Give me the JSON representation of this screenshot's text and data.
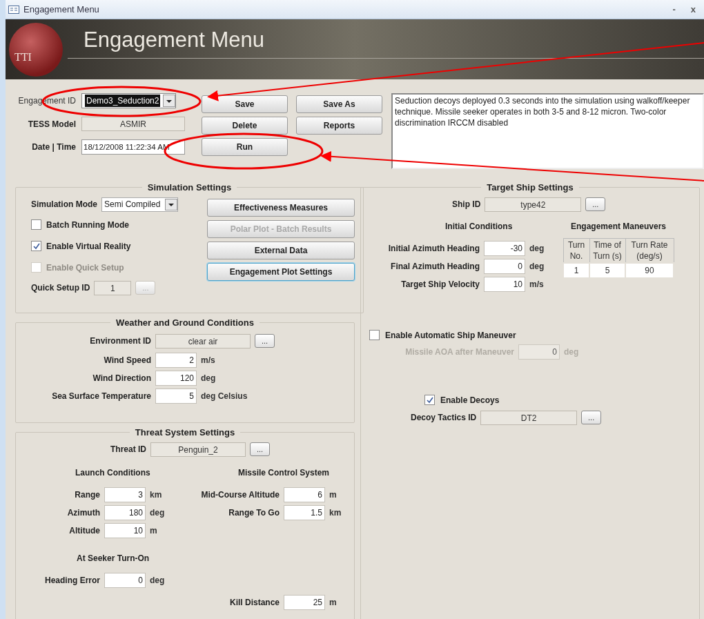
{
  "window": {
    "title": "Engagement Menu",
    "controls": [
      "-",
      "x"
    ]
  },
  "header": {
    "title": "Engagement Menu",
    "logo_text": "TTI"
  },
  "engagement": {
    "id_label": "Engagement ID",
    "id_value": "Demo3_Seduction2",
    "id_highlighted": true,
    "model_label": "TESS Model",
    "model_value": "ASMIR",
    "datetime_label": "Date | Time",
    "datetime_value": "18/12/2008 11:22:34 AM"
  },
  "buttons": [
    {
      "label": "Save"
    },
    {
      "label": "Save As"
    },
    {
      "label": "Delete"
    },
    {
      "label": "Reports"
    },
    {
      "label": "Run"
    }
  ],
  "description": "Seduction decoys deployed 0.3 seconds into the simulation using walkoff/keeper technique.  Missile seeker operates in both 3-5  and 8-12 micron.  Two-color discrimination IRCCM disabled",
  "simulation": {
    "title": "Simulation Settings",
    "mode_label": "Simulation Mode",
    "mode_value": "Semi Compiled",
    "checkboxes": [
      {
        "label": "Batch Running Mode",
        "checked": false,
        "disabled": false
      },
      {
        "label": "Enable Virtual Reality",
        "checked": true,
        "disabled": false
      },
      {
        "label": "Enable Quick Setup",
        "checked": false,
        "disabled": true
      }
    ],
    "quick_setup_label": "Quick Setup ID",
    "quick_setup_value": "1",
    "quick_setup_browse": {
      "label": "...",
      "disabled": true
    },
    "actions": [
      {
        "label": "Effectiveness Measures",
        "disabled": false,
        "focused": false
      },
      {
        "label": "Polar Plot - Batch Results",
        "disabled": true,
        "focused": false
      },
      {
        "label": "External Data",
        "disabled": false,
        "focused": false
      },
      {
        "label": "Engagement Plot Settings",
        "disabled": false,
        "focused": true
      }
    ]
  },
  "weather": {
    "title": "Weather and Ground Conditions",
    "env_label": "Environment ID",
    "env_value": "clear air",
    "browse": "...",
    "fields": [
      {
        "label": "Wind Speed",
        "value": "2",
        "unit": "m/s"
      },
      {
        "label": "Wind Direction",
        "value": "120",
        "unit": "deg"
      },
      {
        "label": "Sea Surface Temperature",
        "value": "5",
        "unit": "deg Celsius"
      }
    ]
  },
  "threat": {
    "title": "Threat System Settings",
    "id_label": "Threat ID",
    "id_value": "Penguin_2",
    "browse": "...",
    "launch": {
      "title": "Launch Conditions",
      "fields": [
        {
          "label": "Range",
          "value": "3",
          "unit": "km"
        },
        {
          "label": "Azimuth",
          "value": "180",
          "unit": "deg"
        },
        {
          "label": "Altitude",
          "value": "10",
          "unit": "m"
        }
      ]
    },
    "control": {
      "title": "Missile Control System",
      "fields": [
        {
          "label": "Mid-Course Altitude",
          "value": "6",
          "unit": "m"
        },
        {
          "label": "Range To Go",
          "value": "1.5",
          "unit": "km"
        }
      ]
    },
    "seeker": {
      "title": "At Seeker Turn-On",
      "fields": [
        {
          "label": "Heading Error",
          "value": "0",
          "unit": "deg"
        }
      ]
    },
    "kill": {
      "label": "Kill Distance",
      "value": "25",
      "unit": "m"
    }
  },
  "target": {
    "title": "Target Ship Settings",
    "ship_label": "Ship ID",
    "ship_value": "type42",
    "browse": "...",
    "initial": {
      "title": "Initial Conditions",
      "fields": [
        {
          "label": "Initial Azimuth Heading",
          "value": "-30",
          "unit": "deg"
        },
        {
          "label": "Final Azimuth Heading",
          "value": "0",
          "unit": "deg"
        },
        {
          "label": "Target Ship Velocity",
          "value": "10",
          "unit": "m/s"
        }
      ]
    },
    "maneuvers": {
      "title": "Engagement Maneuvers",
      "columns": [
        "Turn No.",
        "Time of Turn (s)",
        "Turn Rate (deg/s)"
      ],
      "rows": [
        [
          "1",
          "5",
          "90"
        ]
      ]
    },
    "auto": {
      "label": "Enable Automatic Ship Maneuver",
      "checked": false
    },
    "aoa": {
      "label": "Missile AOA after Maneuver",
      "value": "0",
      "unit": "deg",
      "disabled": true
    },
    "decoys": {
      "label": "Enable Decoys",
      "checked": true
    },
    "decoy_label": "Decoy Tactics ID",
    "decoy_value": "DT2",
    "decoy_browse": "..."
  }
}
